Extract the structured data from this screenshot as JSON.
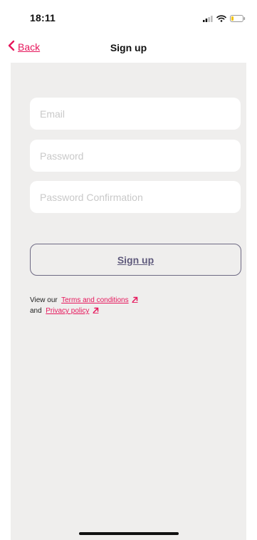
{
  "status_bar": {
    "time": "18:11",
    "icons": [
      "signal-icon",
      "wifi-icon",
      "battery-icon"
    ]
  },
  "nav": {
    "back_label": "Back",
    "title": "Sign up",
    "back_icon": "chevron-left-icon"
  },
  "form": {
    "email": {
      "placeholder": "Email",
      "value": ""
    },
    "password": {
      "placeholder": "Password",
      "value": ""
    },
    "password_confirmation": {
      "placeholder": "Password Confirmation",
      "value": ""
    },
    "submit_label": "Sign up"
  },
  "legal": {
    "prefix": "View our",
    "terms_label": "Terms and conditions",
    "connector": "and",
    "privacy_label": "Privacy policy",
    "link_icon": "external-link-icon"
  },
  "colors": {
    "accent": "#e6175c",
    "background": "#efeeed",
    "button_border": "#6e6a84",
    "button_text": "#5f5a7c",
    "placeholder": "#c9c9c9"
  }
}
